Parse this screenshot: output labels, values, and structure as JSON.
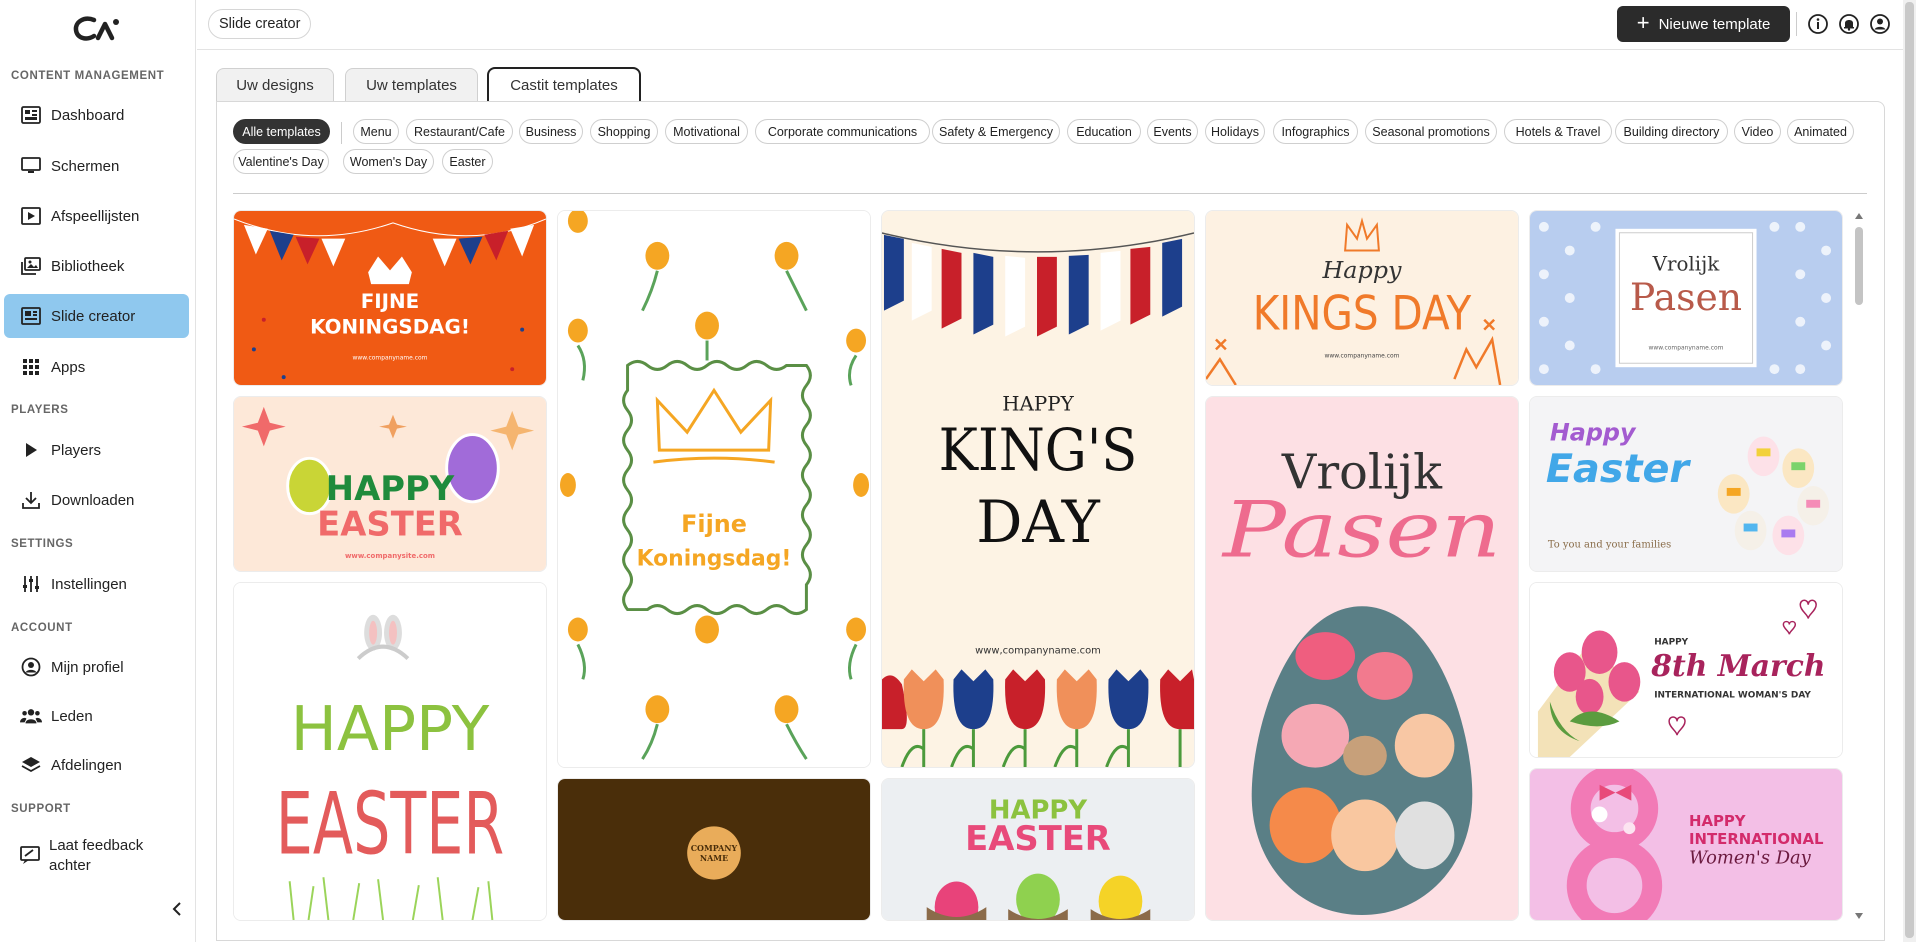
{
  "sidebar": {
    "sections": {
      "content": "CONTENT MANAGEMENT",
      "players": "PLAYERS",
      "settings": "SETTINGS",
      "account": "ACCOUNT",
      "support": "SUPPORT"
    },
    "items": [
      {
        "label": "Dashboard",
        "icon": "dashboard-icon"
      },
      {
        "label": "Schermen",
        "icon": "monitor-icon"
      },
      {
        "label": "Afspeellijsten",
        "icon": "playlist-icon"
      },
      {
        "label": "Bibliotheek",
        "icon": "library-icon"
      },
      {
        "label": "Slide creator",
        "icon": "slide-creator-icon",
        "active": true
      },
      {
        "label": "Apps",
        "icon": "apps-grid-icon"
      },
      {
        "label": "Players",
        "icon": "play-icon"
      },
      {
        "label": "Downloaden",
        "icon": "download-icon"
      },
      {
        "label": "Instellingen",
        "icon": "sliders-icon"
      },
      {
        "label": "Mijn profiel",
        "icon": "user-circle-icon"
      },
      {
        "label": "Leden",
        "icon": "users-icon"
      },
      {
        "label": "Afdelingen",
        "icon": "layers-icon"
      },
      {
        "label": "Laat feedback achter",
        "icon": "feedback-icon"
      }
    ]
  },
  "header": {
    "breadcrumb": "Slide creator",
    "new_template": "Nieuwe template"
  },
  "tabs": [
    {
      "label": "Uw designs"
    },
    {
      "label": "Uw templates"
    },
    {
      "label": "Castit templates",
      "active": true
    }
  ],
  "filters": [
    "Alle templates",
    "Menu",
    "Restaurant/Cafe",
    "Business",
    "Shopping",
    "Motivational",
    "Corporate communications",
    "Safety & Emergency",
    "Education",
    "Events",
    "Holidays",
    "Infographics",
    "Seasonal promotions",
    "Hotels & Travel",
    "Building directory",
    "Video",
    "Animated",
    "Valentine's Day",
    "Women's Day",
    "Easter"
  ],
  "cards": {
    "fijne1": {
      "line1": "FIJNE",
      "line2": "KONINGSDAG!",
      "url": "www.companyname.com"
    },
    "fijne2": {
      "line1": "Fijne",
      "line2": "Koningsdag!"
    },
    "kings": {
      "line1": "HAPPY",
      "line2": "KING'S",
      "line3": "DAY",
      "url": "www,companyname.com"
    },
    "kingsday": {
      "line1": "Happy",
      "line2": "KINGS DAY",
      "url": "www.companyname.com"
    },
    "vrolijk1": {
      "line1": "Vrolijk",
      "line2": "Pasen",
      "url": "www.companyname.com"
    },
    "easter1": {
      "line1": "HAPPY",
      "line2": "EASTER",
      "url": "www.companysite.com"
    },
    "vrolijk2": {
      "line1": "Vrolijk",
      "line2": "Pasen"
    },
    "easter2": {
      "line1": "Happy",
      "line2": "Easter",
      "sub": "To you and your families"
    },
    "easter3": {
      "line1": "HAPPY",
      "line2": "EASTER"
    },
    "march": {
      "line1": "HAPPY",
      "line2": "8th March",
      "line3": "INTERNATIONAL WOMAN'S DAY"
    },
    "company": {
      "line1": "COMPANY",
      "line2": "NAME"
    },
    "easter4": {
      "line1": "HAPPY",
      "line2": "EASTER"
    },
    "womens": {
      "line1": "HAPPY",
      "line2": "INTERNATIONAL",
      "line3": "Women's Day"
    }
  },
  "colors": {
    "active_nav": "#8fc8ee",
    "primary_button": "#2b2b2b",
    "orange": "#f05a14"
  }
}
